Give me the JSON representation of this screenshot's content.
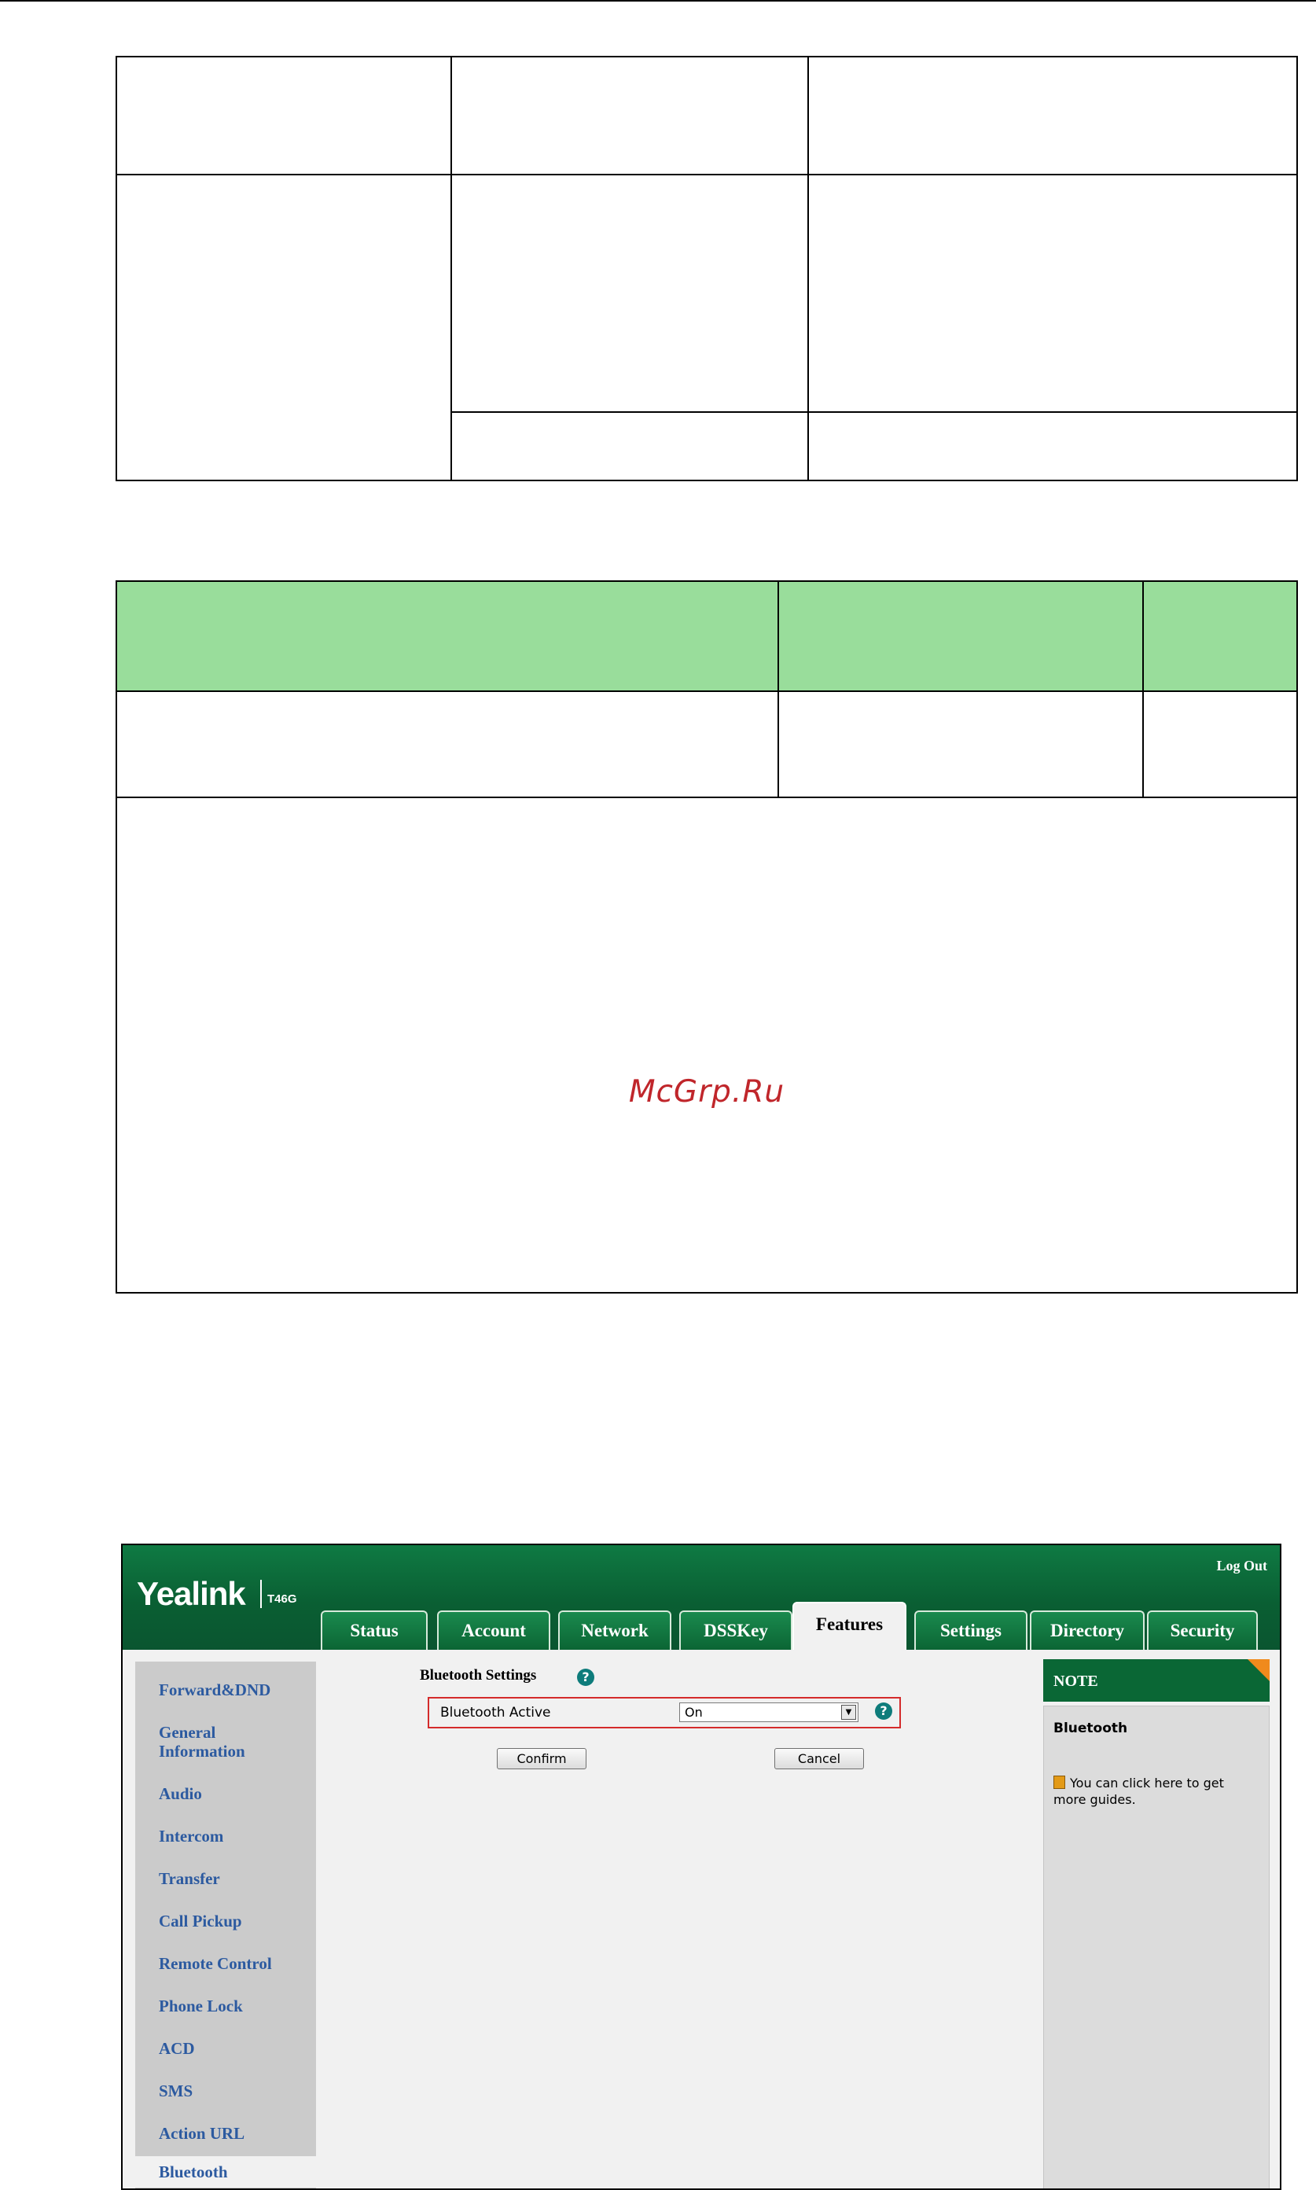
{
  "watermark": "McGrp.Ru",
  "app": {
    "logo": "Yealink",
    "model": "T46G",
    "logout_label": "Log Out",
    "tabs": [
      "Status",
      "Account",
      "Network",
      "DSSKey",
      "Features",
      "Settings",
      "Directory",
      "Security"
    ],
    "active_tab": "Features",
    "sidebar": [
      "Forward&DND",
      "General Information",
      "Audio",
      "Intercom",
      "Transfer",
      "Call Pickup",
      "Remote Control",
      "Phone Lock",
      "ACD",
      "SMS",
      "Action URL",
      "Bluetooth"
    ],
    "active_sidebar": "Bluetooth",
    "section_title": "Bluetooth Settings",
    "field": {
      "label": "Bluetooth Active",
      "value": "On"
    },
    "buttons": {
      "confirm": "Confirm",
      "cancel": "Cancel"
    },
    "note": {
      "header": "NOTE",
      "subtitle": "Bluetooth",
      "text": "You can click here to get more guides."
    },
    "colors": {
      "brand_green": "#0a6735",
      "link_blue": "#2c5aa0",
      "highlight_red": "#d42b2b",
      "table_header_green": "#99dd9b"
    },
    "icons": [
      "help-icon",
      "dropdown-arrow-icon",
      "guide-book-icon",
      "note-corner-icon"
    ]
  }
}
